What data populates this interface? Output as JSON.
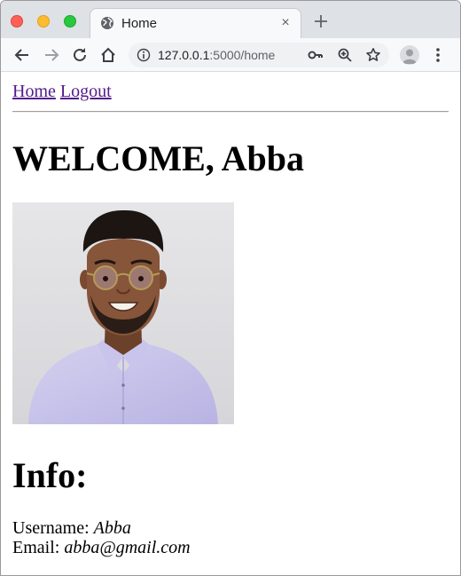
{
  "browser": {
    "tab": {
      "title": "Home",
      "close_glyph": "×",
      "icon": "globe-icon"
    },
    "new_tab_glyph": "+",
    "address": {
      "host": "127.0.0.1",
      "rest": ":5000/home"
    },
    "icons": [
      "back-icon",
      "forward-icon",
      "reload-icon",
      "home-icon",
      "info-icon",
      "key-icon",
      "zoom-icon",
      "star-icon",
      "profile-avatar",
      "menu-icon"
    ]
  },
  "nav": {
    "home_label": "Home",
    "logout_label": "Logout"
  },
  "page": {
    "welcome": "WELCOME, Abba",
    "profile_image": "profile-photo",
    "info_heading": "Info:",
    "username_label": "Username:",
    "username_value": "Abba",
    "email_label": "Email:",
    "email_value": "abba@gmail.com"
  },
  "colors": {
    "link": "#551a8b",
    "tabstrip": "#dee1e6",
    "toolbar": "#f8f9fa"
  }
}
